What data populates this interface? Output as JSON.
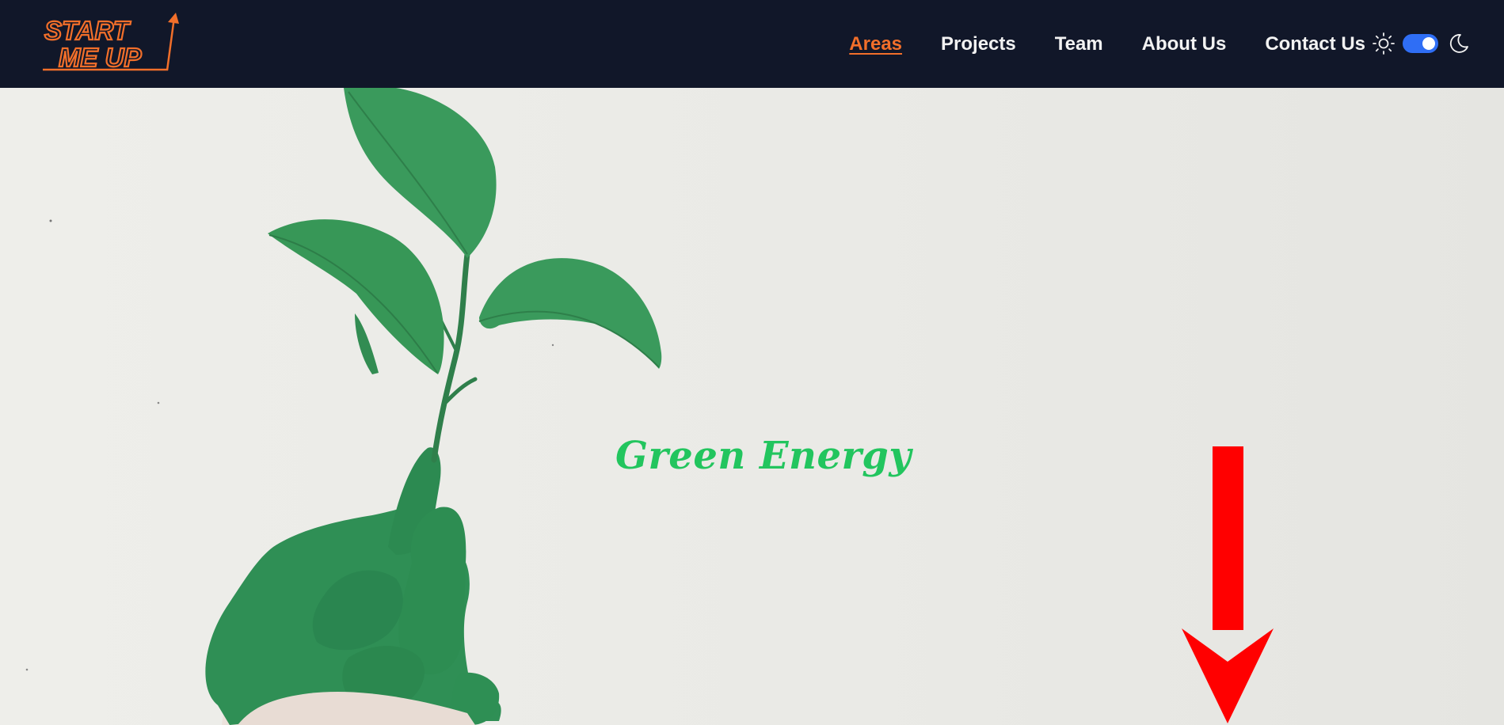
{
  "brand": {
    "logo_line1": "START",
    "logo_line2": "ME UP",
    "accent_color": "#f26f2a"
  },
  "nav": {
    "items": [
      {
        "label": "Areas",
        "active": true
      },
      {
        "label": "Projects",
        "active": false
      },
      {
        "label": "Team",
        "active": false
      },
      {
        "label": "About Us",
        "active": false
      },
      {
        "label": "Contact Us",
        "active": false
      }
    ]
  },
  "theme_toggle": {
    "left_icon": "sun-icon",
    "right_icon": "moon-icon",
    "state": "on",
    "color": "#2f6ef5"
  },
  "hero": {
    "title": "Green Energy",
    "title_color": "#22c55e",
    "image": "green-painted-hand-holding-plant",
    "scroll_icon": "arrow-down-icon",
    "scroll_icon_color": "#ff0000"
  }
}
